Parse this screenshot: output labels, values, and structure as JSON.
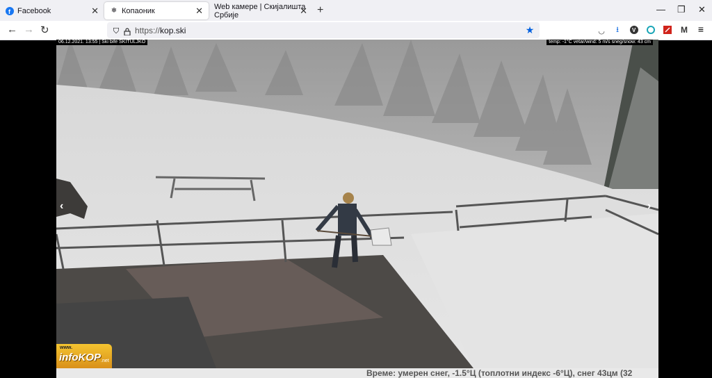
{
  "tabs": [
    {
      "label": "Facebook",
      "icon": "facebook-icon",
      "active": false
    },
    {
      "label": "Копаоник",
      "icon": "snowflake-icon",
      "active": true
    },
    {
      "label": "Web камере | Скијалишта Србије",
      "icon": "",
      "active": false
    }
  ],
  "address": {
    "scheme": "https://",
    "host": "kop.ski"
  },
  "cam": {
    "timestamp": "06.12.2021. 13:55 | Ski bife SKITULJKO",
    "weather": "temp: -1°C vetar/wind: 5 m/s sneg/snow: 43 cm",
    "logo_www": "www.",
    "logo_name": "infoKOP",
    "logo_net": ".net"
  },
  "caption": "Време: умерен снег, -1.5°Ц (топлотни индекс -6°Ц), снег 43цм (32",
  "colors": {
    "tabbar": "#f0f0f4",
    "accent": "#0060df",
    "logo": "#f4c430"
  }
}
